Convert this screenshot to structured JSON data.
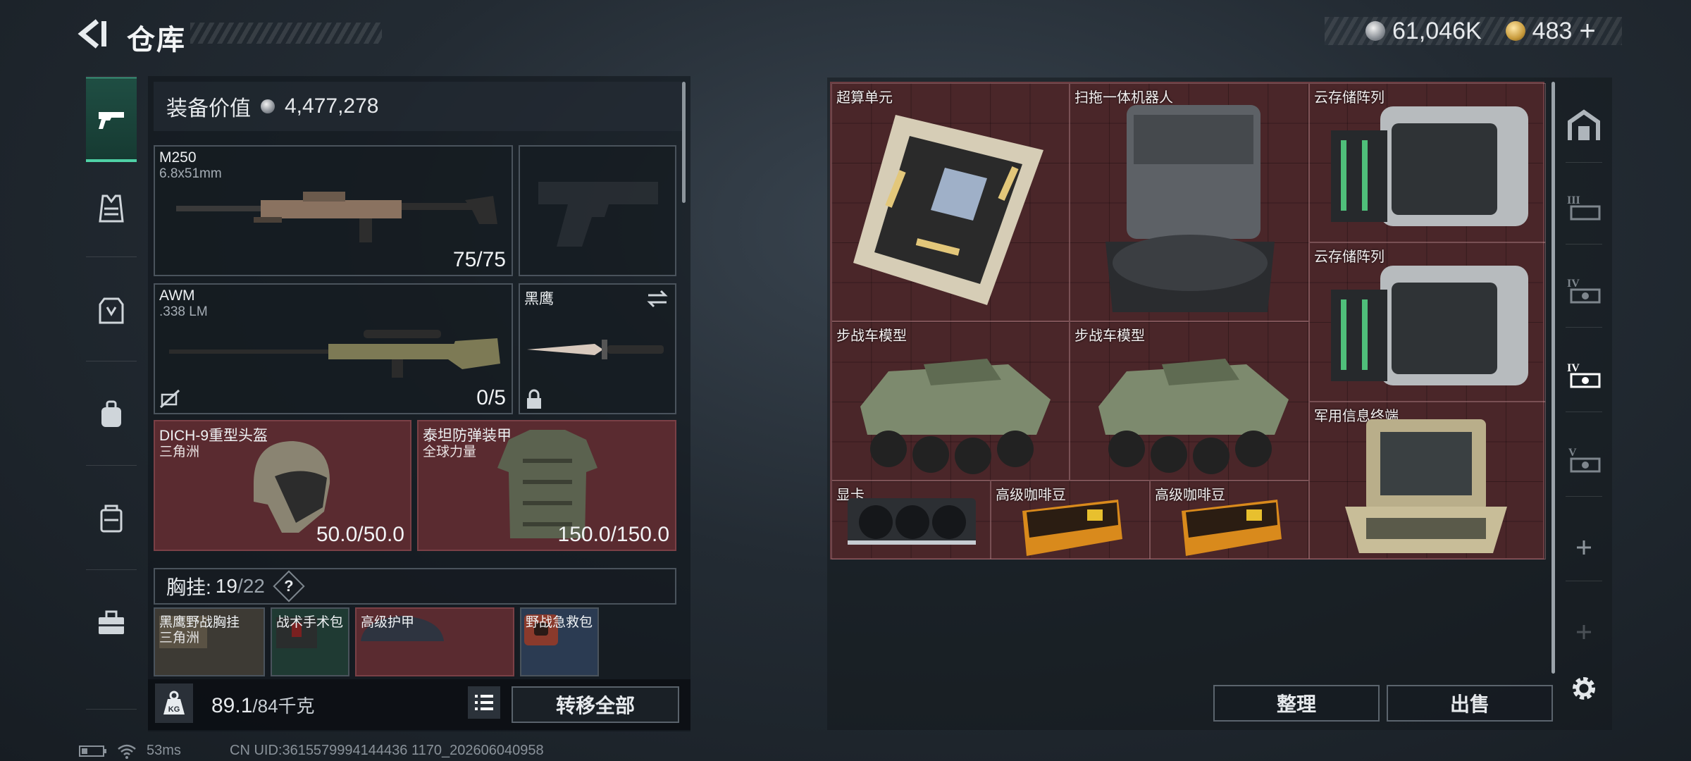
{
  "header": {
    "title": "仓库"
  },
  "currency": {
    "coins": "61,046K",
    "tokens": "483",
    "plus": "+"
  },
  "equipment": {
    "value_label": "装备价值",
    "value": "4,477,278",
    "primary": {
      "name": "M250",
      "caliber": "6.8x51mm",
      "ammo": "75/75"
    },
    "secondary": {
      "name": "AWM",
      "caliber": ".338 LM",
      "ammo": "0/5"
    },
    "melee": {
      "name": "黑鹰"
    },
    "helmet": {
      "name": "DICH-9重型头盔",
      "faction": "三角洲",
      "durability": "50.0/50.0"
    },
    "armor": {
      "name": "泰坦防弹装甲",
      "faction": "全球力量",
      "durability": "150.0/150.0"
    },
    "rig": {
      "label": "胸挂:",
      "used": "19",
      "total": "/22",
      "help": "?"
    },
    "rig_items": [
      {
        "name": "黑鹰野战胸挂",
        "sub": "三角洲"
      },
      {
        "name": "战术手术包"
      },
      {
        "name": "高级护甲"
      },
      {
        "name": "野战急救包"
      }
    ]
  },
  "weight": {
    "current": "89.1",
    "max": "/84千克"
  },
  "buttons": {
    "transfer_all": "转移全部",
    "sort": "整理",
    "sell": "出售"
  },
  "storage_items": [
    {
      "name": "超算单元"
    },
    {
      "name": "扫拖一体机器人"
    },
    {
      "name": "云存储阵列"
    },
    {
      "name": "云存储阵列"
    },
    {
      "name": "步战车模型"
    },
    {
      "name": "步战车模型"
    },
    {
      "name": "军用信息终端"
    },
    {
      "name": "显卡"
    },
    {
      "name": "高级咖啡豆"
    },
    {
      "name": "高级咖啡豆"
    }
  ],
  "right_tabs": [
    "home-tab",
    "tier-3-tab",
    "tier-4-tab",
    "tier-4-active-tab",
    "tier-5-tab",
    "add-tab",
    "add-tab-disabled"
  ],
  "status": {
    "ping": "53ms",
    "uid": "CN UID:3615579994144436 1170_202606040958"
  }
}
